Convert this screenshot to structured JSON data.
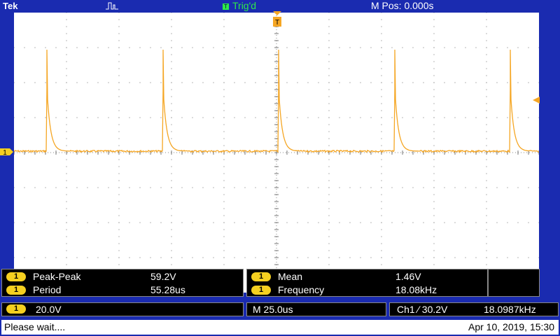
{
  "header": {
    "brand": "Tek",
    "trigger_status": "Trig'd",
    "position": "M Pos: 0.000s"
  },
  "channel": {
    "number": "1",
    "color": "#f5a623"
  },
  "measurements": {
    "left": [
      {
        "label": "Peak-Peak",
        "value": "59.2V"
      },
      {
        "label": "Period",
        "value": "55.28us"
      }
    ],
    "right": [
      {
        "label": "Mean",
        "value": "1.46V"
      },
      {
        "label": "Frequency",
        "value": "18.08kHz"
      }
    ]
  },
  "settings": {
    "volts_per_div": "20.0V",
    "time_per_div": "M 25.0us",
    "trigger": "Ch1 ∕ 30.2V",
    "trigger_freq": "18.0987kHz"
  },
  "status": {
    "message": "Please wait....",
    "datetime": "Apr 10, 2019, 15:30"
  },
  "colors": {
    "background": "#1a2bb0",
    "screen": "#ffffff",
    "trace": "#f5a623",
    "badge": "#f5d020",
    "trigger_green": "#2ee84a"
  },
  "icons": [
    "acquisition-icon",
    "trigger-marker-icon",
    "trigger-level-icon",
    "channel-ground-icon"
  ]
}
